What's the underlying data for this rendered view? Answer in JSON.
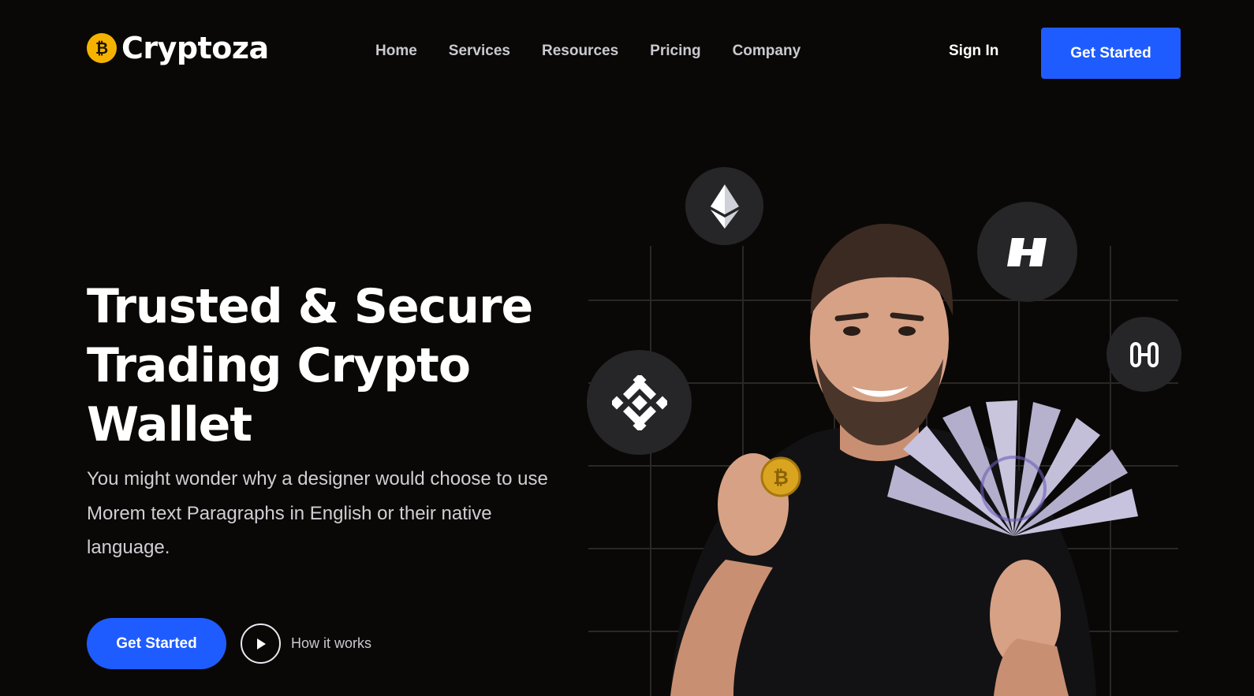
{
  "header": {
    "brand": "Cryptoza",
    "nav": [
      "Home",
      "Services",
      "Resources",
      "Pricing",
      "Company"
    ],
    "sign_in": "Sign In",
    "cta": "Get Started"
  },
  "hero": {
    "title_lines": [
      "Trusted & Secure",
      "Trading Crypto",
      "Wallet"
    ],
    "description": "You might wonder why a designer would choose to use Morem text Paragraphs in English or their native language.",
    "cta": "Get Started",
    "secondary": "How it works"
  },
  "icons": {
    "logo": "bitcoin-icon",
    "badges": [
      "ethereum-icon",
      "binance-icon",
      "harmony-icon",
      "one-icon"
    ],
    "play": "play-icon"
  },
  "colors": {
    "background": "#0a0806",
    "accent": "#1f5cff",
    "logo": "#f5b300",
    "badge": "#262628"
  }
}
